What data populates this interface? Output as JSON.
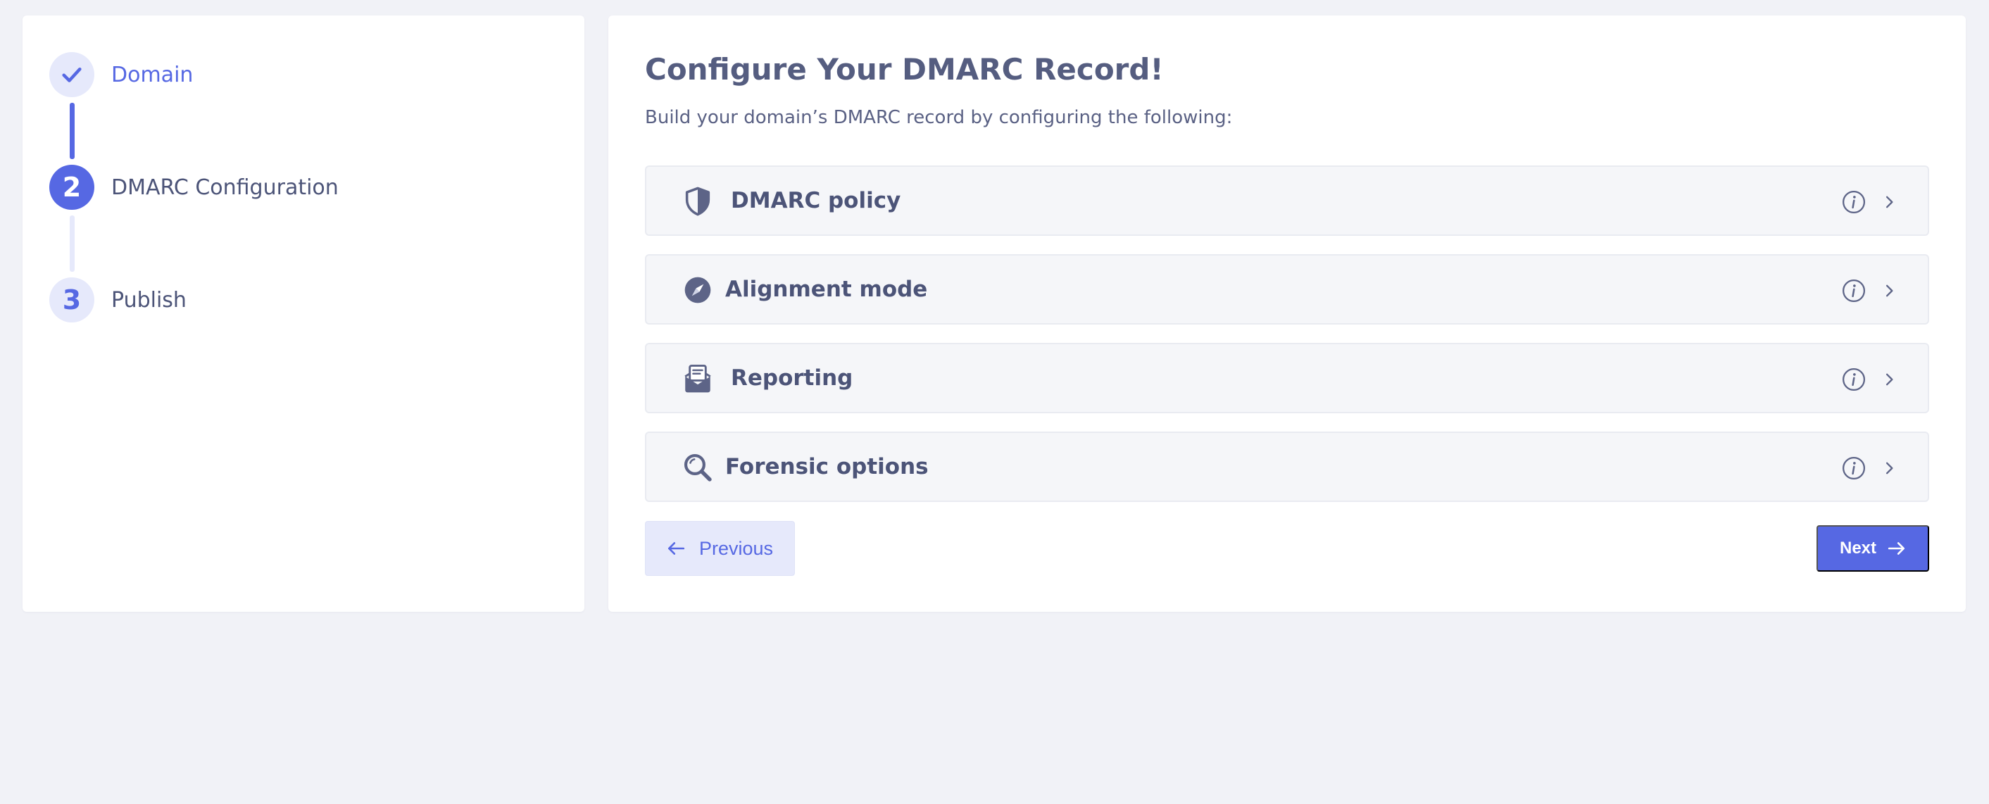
{
  "stepper": {
    "steps": [
      {
        "number": "",
        "label": "Domain",
        "state": "done"
      },
      {
        "number": "2",
        "label": "DMARC Configuration",
        "state": "active"
      },
      {
        "number": "3",
        "label": "Publish",
        "state": "pending"
      }
    ]
  },
  "main": {
    "title": "Configure Your DMARC Record!",
    "subtitle": "Build your domain’s DMARC record by configuring the following:",
    "sections": [
      {
        "label": "DMARC policy",
        "icon": "shield-icon"
      },
      {
        "label": "Alignment mode",
        "icon": "compass-icon"
      },
      {
        "label": "Reporting",
        "icon": "mail-open-icon"
      },
      {
        "label": "Forensic options",
        "icon": "magnifier-icon"
      }
    ],
    "previous_label": "Previous",
    "next_label": "Next"
  },
  "colors": {
    "accent": "#5668e3",
    "accent_light": "#e6e9fb",
    "text": "#4c5478",
    "background": "#f1f2f7"
  }
}
